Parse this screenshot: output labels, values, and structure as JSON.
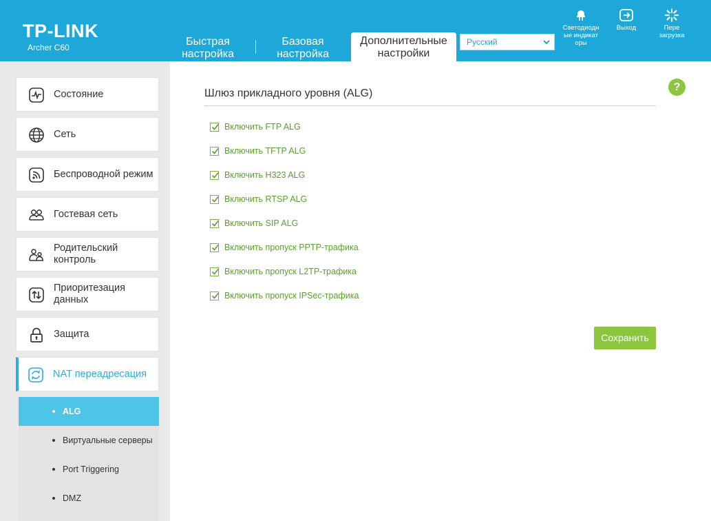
{
  "header": {
    "brand": "TP-LINK",
    "model": "Archer C60",
    "tabs": [
      {
        "label_line1": "Быстрая",
        "label_line2": "настройка"
      },
      {
        "label_line1": "Базовая",
        "label_line2": "настройка"
      },
      {
        "label_line1": "Дополнительные",
        "label_line2": "настройки"
      }
    ],
    "language": "Русский",
    "led_label_1": "Светодиодн",
    "led_label_2": "ые индикат",
    "led_label_3": "оры",
    "logout_label": "Выход",
    "reboot_label_1": "Пере",
    "reboot_label_2": "загрузка"
  },
  "sidebar": {
    "items": [
      {
        "label": "Состояние",
        "icon": "status-icon"
      },
      {
        "label": "Сеть",
        "icon": "globe-icon"
      },
      {
        "label": "Беспроводной режим",
        "icon": "wireless-icon"
      },
      {
        "label": "Гостевая сеть",
        "icon": "guest-network-icon"
      },
      {
        "label": "Родительский контроль",
        "icon": "parental-control-icon"
      },
      {
        "label": "Приоритезация данных",
        "icon": "qos-icon"
      },
      {
        "label": "Защита",
        "icon": "lock-icon"
      },
      {
        "label": "NAT переадресация",
        "icon": "nat-icon"
      }
    ],
    "subitems": [
      {
        "label": "ALG"
      },
      {
        "label": "Виртуальные серверы"
      },
      {
        "label": "Port Triggering"
      },
      {
        "label": "DMZ"
      }
    ]
  },
  "main": {
    "title": "Шлюз прикладного уровня (ALG)",
    "help": "?",
    "options": [
      {
        "label": "Включить FTP ALG",
        "checked": true
      },
      {
        "label": "Включить TFTP ALG",
        "checked": true
      },
      {
        "label": "Включить H323 ALG",
        "checked": true
      },
      {
        "label": "Включить RTSP ALG",
        "checked": true
      },
      {
        "label": "Включить SIP ALG",
        "checked": true
      },
      {
        "label": "Включить пропуск PPTP-трафика",
        "checked": true
      },
      {
        "label": "Включить пропуск L2TP-трафика",
        "checked": true
      },
      {
        "label": "Включить пропуск IPSec-трафика",
        "checked": true
      }
    ],
    "save_label": "Сохранить"
  },
  "colors": {
    "header_bg": "#1ea8d9",
    "accent_green": "#8cc63f",
    "active_blue": "#4ec4e6"
  }
}
